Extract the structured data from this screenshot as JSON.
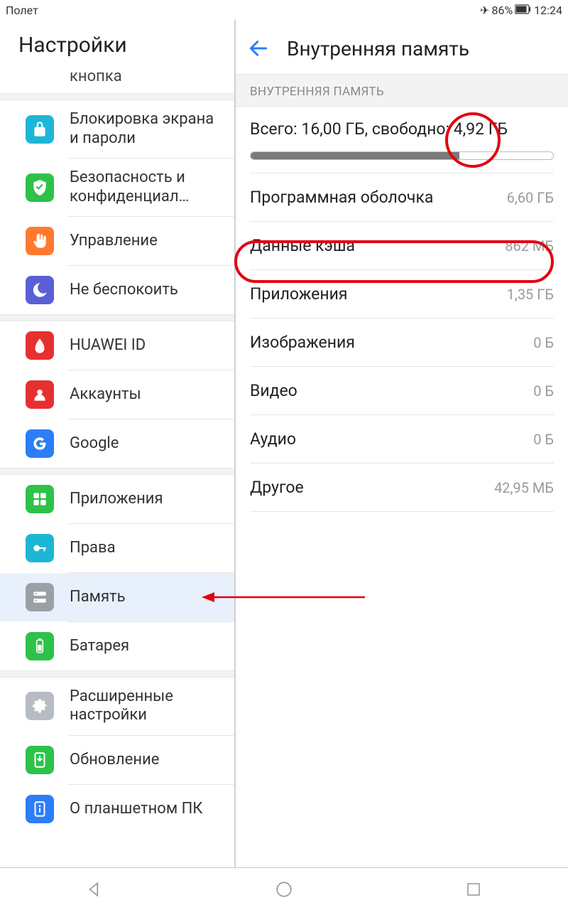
{
  "status": {
    "mode": "Полет",
    "battery": "86%",
    "time": "12:24"
  },
  "sidebar": {
    "title": "Настройки",
    "items": [
      {
        "label": "кнопка",
        "partial": true
      },
      {
        "label": "Блокировка экрана и пароли"
      },
      {
        "label": "Безопасность и конфиденциал…"
      },
      {
        "label": "Управление"
      },
      {
        "label": "Не беспокоить"
      },
      {
        "label": "HUAWEI ID"
      },
      {
        "label": "Аккаунты"
      },
      {
        "label": "Google"
      },
      {
        "label": "Приложения"
      },
      {
        "label": "Права"
      },
      {
        "label": "Память",
        "selected": true
      },
      {
        "label": "Батарея"
      },
      {
        "label": "Расширенные настройки"
      },
      {
        "label": "Обновление"
      },
      {
        "label": "О планшетном ПК"
      }
    ]
  },
  "main": {
    "title": "Внутренняя память",
    "section_header": "ВНУТРЕННЯЯ ПАМЯТЬ",
    "summary_prefix": "Всего: 16,00 ГБ, свободно:",
    "summary_free": " 4,92 ГБ",
    "storage": [
      {
        "name": "Программная оболочка",
        "val": "6,60 ГБ"
      },
      {
        "name": "Данные кэша",
        "val": "862 МБ"
      },
      {
        "name": "Приложения",
        "val": "1,35 ГБ"
      },
      {
        "name": "Изображения",
        "val": "0 Б"
      },
      {
        "name": "Видео",
        "val": "0 Б"
      },
      {
        "name": "Аудио",
        "val": "0 Б"
      },
      {
        "name": "Другое",
        "val": "42,95 МБ"
      }
    ]
  }
}
